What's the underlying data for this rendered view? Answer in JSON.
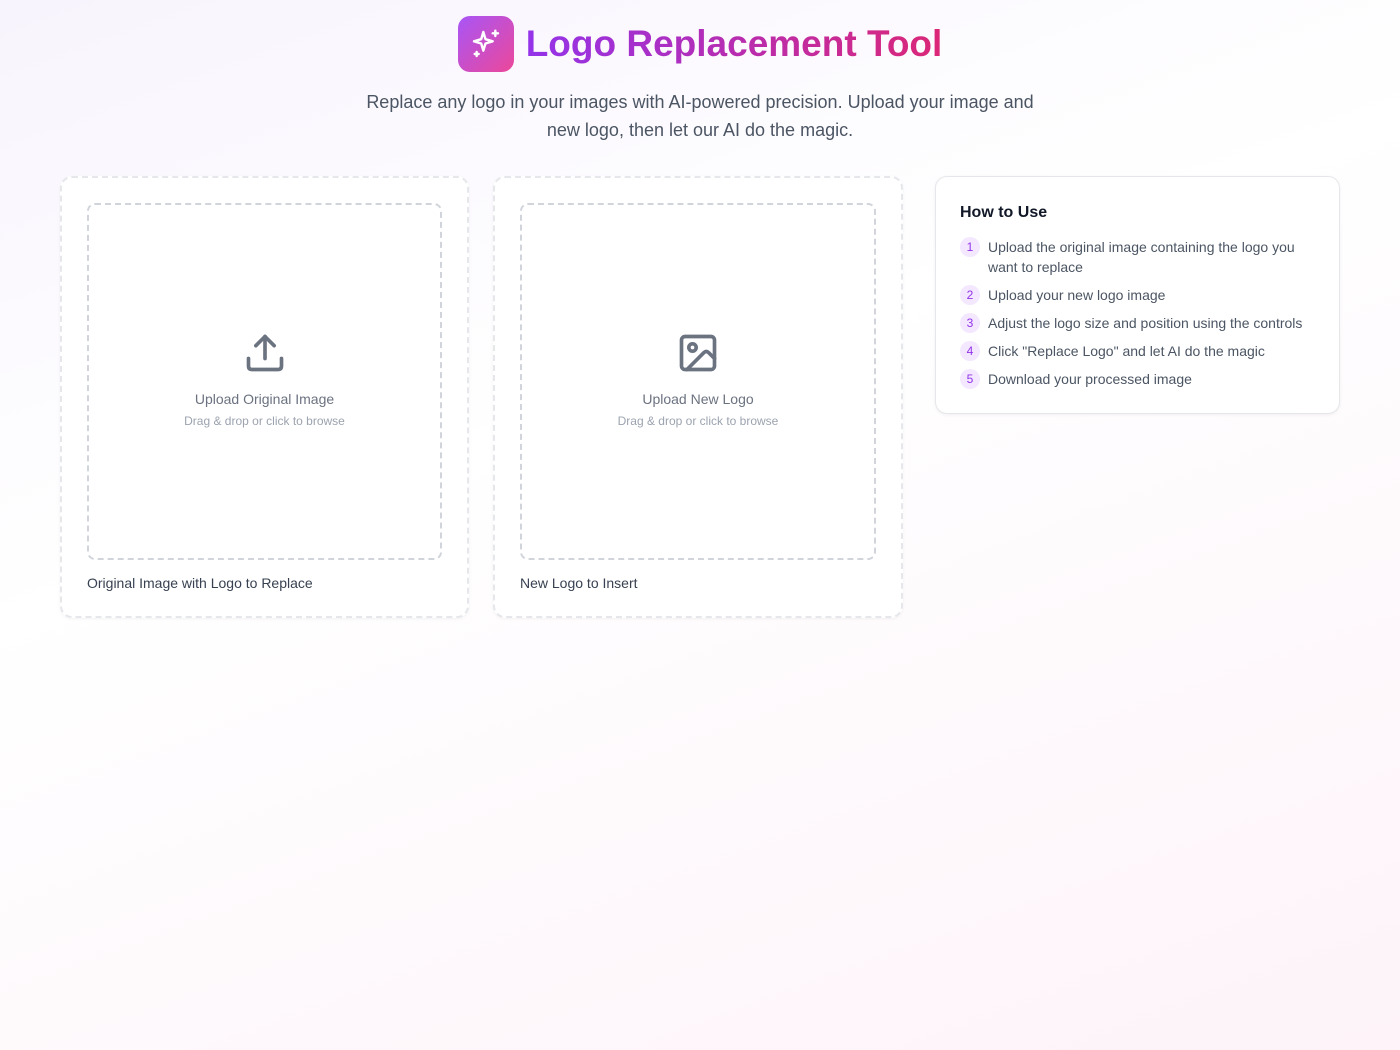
{
  "header": {
    "logo_icon": "sparkles-icon",
    "title": "Logo Replacement Tool",
    "subtitle": "Replace any logo in your images with AI-powered precision. Upload your image and new logo, then let our AI do the magic."
  },
  "uploads": [
    {
      "icon": "upload-icon",
      "title": "Upload Original Image",
      "hint": "Drag & drop or click to browse",
      "caption": "Original Image with Logo to Replace"
    },
    {
      "icon": "image-icon",
      "title": "Upload New Logo",
      "hint": "Drag & drop or click to browse",
      "caption": "New Logo to Insert"
    }
  ],
  "howto": {
    "title": "How to Use",
    "steps": [
      {
        "num": "1",
        "text": "Upload the original image containing the logo you want to replace"
      },
      {
        "num": "2",
        "text": "Upload your new logo image"
      },
      {
        "num": "3",
        "text": "Adjust the logo size and position using the controls"
      },
      {
        "num": "4",
        "text": "Click \"Replace Logo\" and let AI do the magic"
      },
      {
        "num": "5",
        "text": "Download your processed image"
      }
    ]
  },
  "colors": {
    "accent_purple": "#9333ea",
    "accent_pink": "#db2777",
    "badge_bg": "#f3e8ff"
  }
}
